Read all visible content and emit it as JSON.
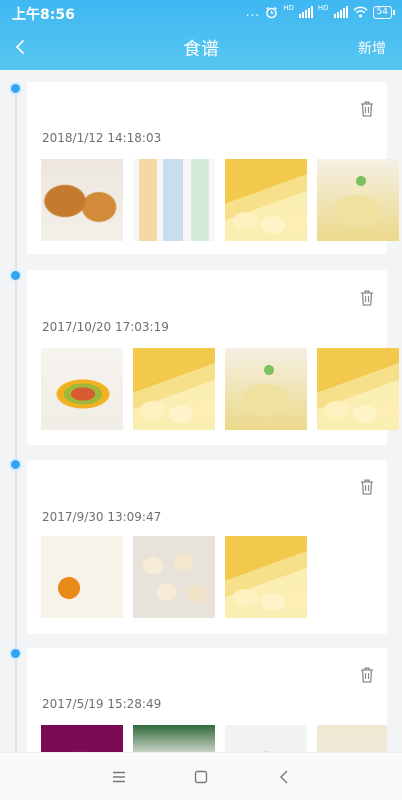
{
  "status_bar": {
    "time": "上午8:56",
    "dots": "...",
    "sim1_label": "HD",
    "sim2_label": "HD",
    "battery": "54"
  },
  "header": {
    "title": "食谱",
    "add_label": "新增"
  },
  "accent_color": "#31a6f0",
  "records": [
    {
      "date": "2018/1/12 14:18:03",
      "photos": [
        "fried-chicken-photo",
        "yogurt-bottles-photo",
        "banana-photo",
        "banana-bowl-photo"
      ]
    },
    {
      "date": "2017/10/20 17:03:19",
      "photos": [
        "dried-fruit-platter-photo",
        "banana-photo",
        "banana-bowl-photo",
        "banana-photo"
      ]
    },
    {
      "date": "2017/9/30 13:09:47",
      "photos": [
        "salted-egg-photo",
        "steamed-buns-photo",
        "banana-photo"
      ]
    },
    {
      "date": "2017/5/19 15:28:49",
      "photos": [
        "flower-photo",
        "roast-meat-photo",
        "vegetable-soup-photo",
        "greens-photo"
      ]
    }
  ]
}
